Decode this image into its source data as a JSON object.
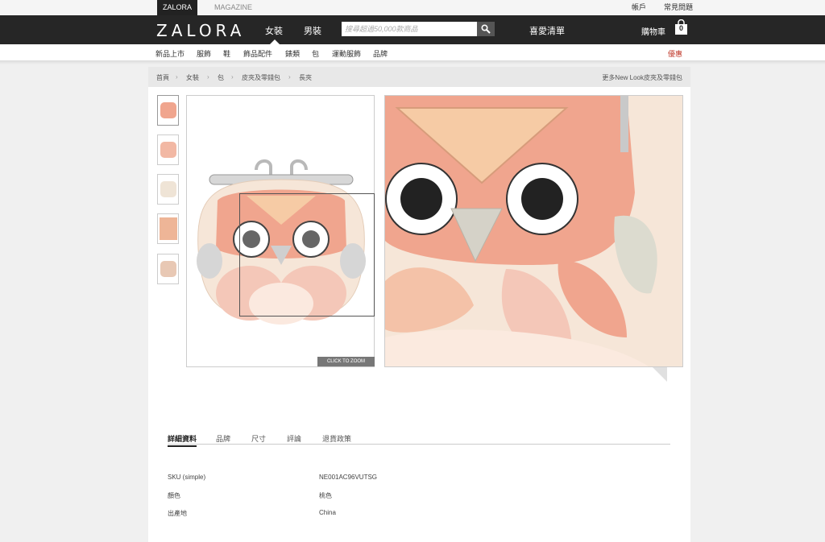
{
  "topbar": {
    "zalora_tab": "ZALORA",
    "magazine_tab": "MAGAZINE",
    "account": "帳戶",
    "faq": "常見問題"
  },
  "header": {
    "logo": "ZALORA",
    "nav_women": "女裝",
    "nav_men": "男裝",
    "search_placeholder": "搜尋超過50,000款商品",
    "wishlist": "喜愛清單",
    "cart_label": "購物車",
    "cart_count": "0"
  },
  "subnav": {
    "items": [
      "新品上市",
      "服飾",
      "鞋",
      "飾品配件",
      "錶類",
      "包",
      "運動服飾",
      "品牌"
    ],
    "promo": "優惠"
  },
  "breadcrumb": {
    "items": [
      "首頁",
      "女裝",
      "包",
      "皮夾及零錢包",
      "長夾"
    ],
    "more_link": "更多New Look皮夾及零錢包"
  },
  "gallery": {
    "thumbnail_count": 5,
    "click_to_zoom": "CLICK TO ZOOM"
  },
  "tabs": {
    "items": [
      "詳細資料",
      "品牌",
      "尺寸",
      "評論",
      "退貨政策"
    ],
    "active": "詳細資料"
  },
  "details": [
    {
      "label": "SKU (simple)",
      "value": "NE001AC96VUTSG"
    },
    {
      "label": "顏色",
      "value": "桃色"
    },
    {
      "label": "出產地",
      "value": "China"
    }
  ],
  "colors": {
    "header_bg": "#262626",
    "promo": "#c0392b",
    "owl_pink": "#f0a58e",
    "owl_cream": "#f6e6d8"
  }
}
